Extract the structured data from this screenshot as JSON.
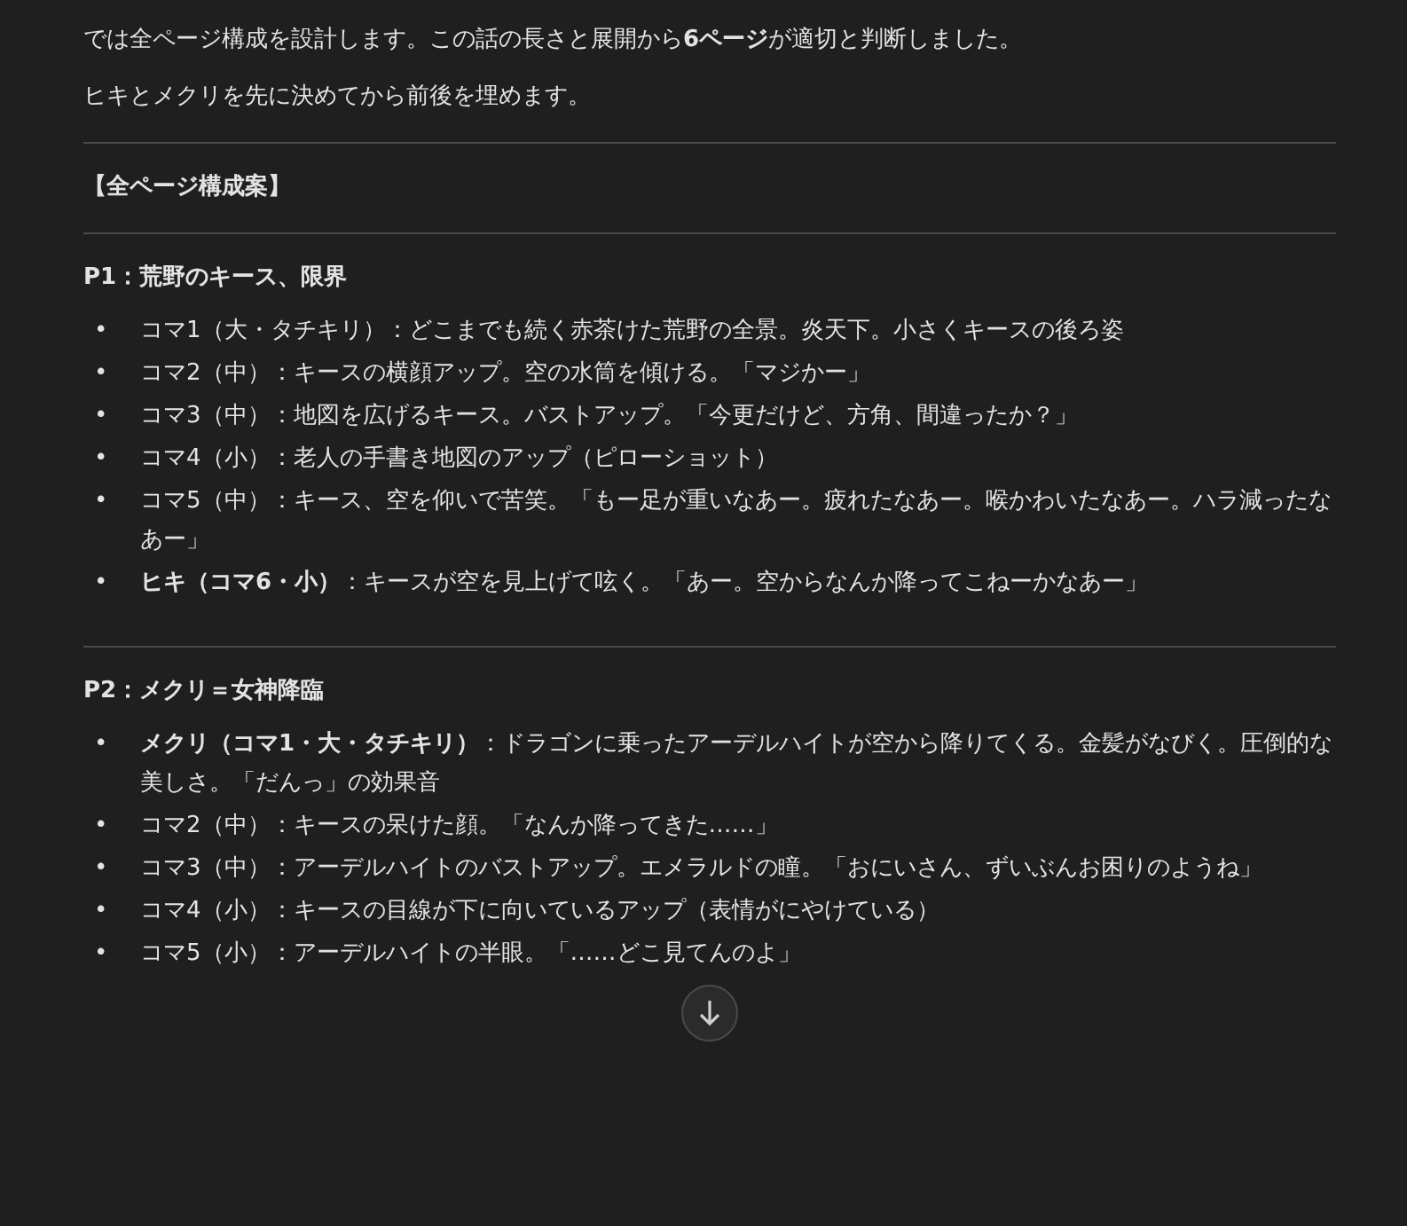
{
  "intro": [
    "では全ページ構成を設計します。この話の長さと展開から**6ページ**が適切と判断しました。",
    "ヒキとメクリを先に決めてから前後を埋めます。"
  ],
  "plan_title": "【全ページ構成案】",
  "pages": [
    {
      "title": "P1：荒野のキース、限界",
      "panels": [
        {
          "bullet": "•",
          "text": "コマ1（大・タチキリ）：どこまでも続く赤茶けた荒野の全景。炎天下。小さくキースの後ろ姿"
        },
        {
          "bullet": "•",
          "text": "コマ2（中）：キースの横顔アップ。空の水筒を傾ける。「マジかー」"
        },
        {
          "bullet": "•",
          "text": "コマ3（中）：地図を広げるキース。バストアップ。「今更だけど、方角、間違ったか？」"
        },
        {
          "bullet": "•",
          "text": "コマ4（小）：老人の手書き地図のアップ（ピローショット）"
        },
        {
          "bullet": "•",
          "text": "コマ5（中）：キース、空を仰いで苦笑。「もー足が重いなあー。疲れたなあー。喉かわいたなあー。ハラ減ったなあー」"
        },
        {
          "bullet": "•",
          "text": "**ヒキ（コマ6・小）**：キースが空を見上げて呟く。「あー。空からなんか降ってこねーかなあー」"
        }
      ]
    },
    {
      "title": "P2：メクリ＝女神降臨",
      "panels": [
        {
          "bullet": "•",
          "text": "**メクリ（コマ1・大・タチキリ）**：ドラゴンに乗ったアーデルハイトが空から降りてくる。金髪がなびく。圧倒的な美しさ。「だんっ」の効果音"
        },
        {
          "bullet": "•",
          "text": "コマ2（中）：キースの呆けた顔。「なんか降ってきた……」"
        },
        {
          "bullet": "•",
          "text": "コマ3（中）：アーデルハイトのバストアップ。エメラルドの瞳。「おにいさん、ずいぶんお困りのようね」"
        },
        {
          "bullet": "•",
          "text": "コマ4（小）：キースの目線が下に向いているアップ（表情がにやけている）"
        },
        {
          "bullet": "•",
          "text": "コマ5（小）：アーデルハイトの半眼。「……どこ見てんのよ」"
        }
      ]
    }
  ]
}
